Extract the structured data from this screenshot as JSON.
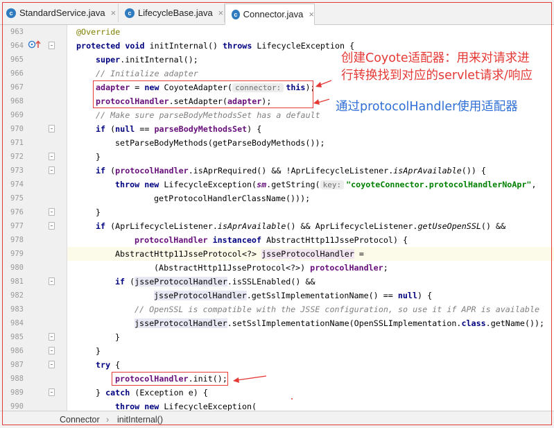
{
  "tabs": [
    {
      "icon": "c",
      "label": "StandardService.java",
      "active": false,
      "close": "×"
    },
    {
      "icon": "c",
      "label": "LifecycleBase.java",
      "active": false,
      "close": "×"
    },
    {
      "icon": "c",
      "label": "Connector.java",
      "active": true,
      "close": "×"
    }
  ],
  "gutter": {
    "line_numbers": [
      "963",
      "964",
      "965",
      "966",
      "967",
      "968",
      "969",
      "970",
      "971",
      "972",
      "973",
      "974",
      "975",
      "976",
      "977",
      "978",
      "979",
      "980",
      "981",
      "982",
      "983",
      "984",
      "985",
      "986",
      "987",
      "988",
      "989",
      "990"
    ]
  },
  "code": {
    "l963": {
      "annotation": "@Override"
    },
    "l964": {
      "kw1": "protected",
      "kw2": "void",
      "sig": " initInternal() ",
      "kw3": "throws",
      "rest": " LifecycleException {"
    },
    "l965": {
      "kw": "super",
      "rest": ".initInternal();"
    },
    "l966": {
      "comment": "// Initialize adapter"
    },
    "l967": {
      "field": "adapter",
      "mid": " = ",
      "kw": "new",
      "ctor": " CoyoteAdapter(",
      "hint": "connector:",
      "kw2": "this",
      "end": ");"
    },
    "l968": {
      "field": "protocolHandler",
      "mid": ".setAdapter(",
      "field2": "adapter",
      "end": ");"
    },
    "l969": {
      "comment": "// Make sure parseBodyMethodsSet has a default"
    },
    "l970": {
      "kw": "if",
      "p1": " (",
      "kw2": "null",
      "mid": " == ",
      "field": "parseBodyMethodsSet",
      "end": ") {"
    },
    "l971": {
      "text": "setParseBodyMethods(getParseBodyMethods());"
    },
    "l972": {
      "text": "}"
    },
    "l973": {
      "kw": "if",
      "p1": " (",
      "field": "protocolHandler",
      "mid": ".isAprRequired() && !AprLifecycleListener.",
      "it": "isAprAvailable",
      "end": "()) {"
    },
    "l974": {
      "kw": "throw",
      "kw2": "new",
      "mid": " LifecycleException(",
      "field": "sm",
      "mid2": ".getString(",
      "hint": "key:",
      "str": "\"coyoteConnector.protocolHandlerNoApr\"",
      "end": ","
    },
    "l975": {
      "text": "getProtocolHandlerClassName()));"
    },
    "l976": {
      "text": "}"
    },
    "l977": {
      "kw": "if",
      "p1": " (AprLifecycleListener.",
      "it1": "isAprAvailable",
      "mid": "() && AprLifecycleListener.",
      "it2": "getUseOpenSSL",
      "end": "() &&"
    },
    "l978": {
      "field": "protocolHandler",
      "kw": "instanceof",
      "end": " AbstractHttp11JsseProtocol) {"
    },
    "l979": {
      "type": "AbstractHttp11JsseProtocol<?> ",
      "var": "jsseProtocolHandler",
      "end": " ="
    },
    "l980": {
      "text": "(AbstractHttp11JsseProtocol<?>) ",
      "field": "protocolHandler",
      "end": ";"
    },
    "l981": {
      "kw": "if",
      "p1": " (",
      "var": "jsseProtocolHandler",
      "end": ".isSSLEnabled() &&"
    },
    "l982": {
      "var": "jsseProtocolHandler",
      "mid": ".getSslImplementationName() == ",
      "kw": "null",
      "end": ") {"
    },
    "l983": {
      "comment": "// OpenSSL is compatible with the JSSE configuration, so use it if APR is available"
    },
    "l984": {
      "var": "jsseProtocolHandler",
      "mid": ".setSslImplementationName(OpenSSLImplementation.",
      "kw": "class",
      "end": ".getName());"
    },
    "l985": {
      "text": "}"
    },
    "l986": {
      "text": "}"
    },
    "l987": {
      "kw": "try",
      "end": " {"
    },
    "l988": {
      "field": "protocolHandler",
      "end": ".init();"
    },
    "l989": {
      "p0": "} ",
      "kw": "catch",
      "end": " (Exception e) {"
    },
    "l990": {
      "kw": "throw",
      "kw2": "new",
      "end": " LifecycleException("
    }
  },
  "annotations": {
    "callout1_line1": "创建Coyote适配器：用来对请求进",
    "callout1_line2": "行转换找到对应的servlet请求/响应",
    "callout2": "通过protocolHandler使用适配器",
    "color": "#e53935",
    "callout2_color": "#2f6fd6"
  },
  "breadcrumb": {
    "items": [
      "Connector",
      "initInternal()"
    ],
    "separator": "›"
  },
  "colors": {
    "keyword": "#000080",
    "field": "#660e7a",
    "string": "#008000",
    "comment": "#808080",
    "annotation": "#808000"
  }
}
